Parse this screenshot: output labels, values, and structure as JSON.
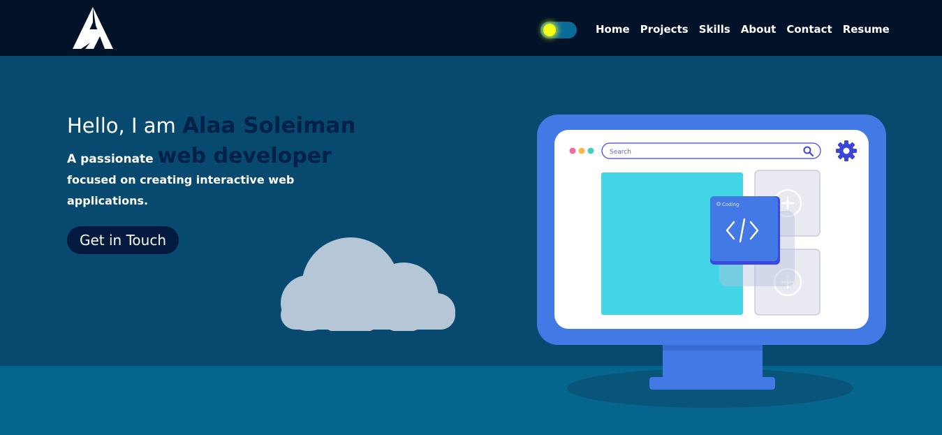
{
  "nav": {
    "logo": "as-monogram-logo",
    "theme_toggle": {
      "state": "on",
      "knob_color": "#f3ff17"
    },
    "links": [
      "Home",
      "Projects",
      "Skills",
      "About",
      "Contact",
      "Resume"
    ]
  },
  "hero": {
    "greeting_prefix": "Hello, I am ",
    "name": "Alaa Soleiman",
    "role_prefix": "A passionate ",
    "role_highlight": "web developer",
    "description": "focused on creating interactive web applications.",
    "cta_label": "Get in Touch"
  },
  "illustration": {
    "search_placeholder": "Search",
    "card_label": "Coding",
    "icons": [
      "search-icon",
      "gear-icon",
      "code-icon",
      "plus-icon"
    ]
  },
  "colors": {
    "navbar": "#011229",
    "hero_bg": "#07496f",
    "ground": "#06658c",
    "accent_dark": "#04214a",
    "monitor_blue": "#4379e5",
    "panel_cyan": "#42d5e6"
  }
}
